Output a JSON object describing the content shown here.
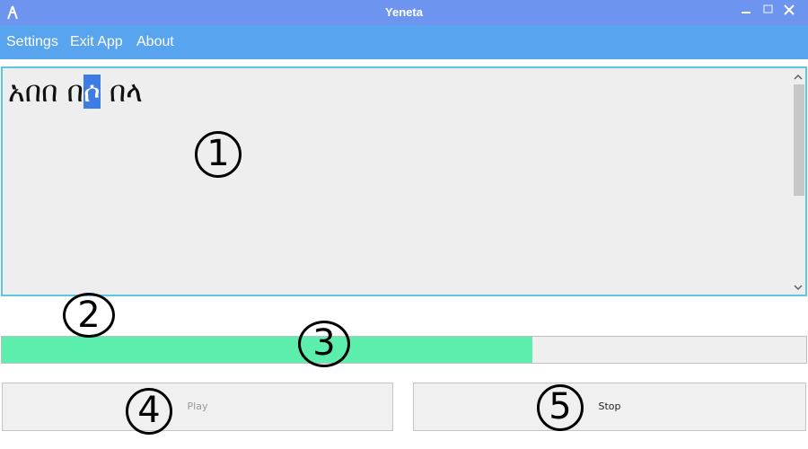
{
  "window": {
    "title": "Yeneta",
    "app_icon": "amharic-letter-icon",
    "controls": [
      "minimize-icon",
      "maximize-icon",
      "close-icon"
    ]
  },
  "menu": {
    "settings": "Settings",
    "exit_app": "Exit App",
    "about": "About"
  },
  "editor": {
    "text_before": "አበበ በ",
    "text_selected": "ሶ",
    "text_after": " በላ"
  },
  "progress": {
    "value": 0.66,
    "fill_color": "#5ceeac"
  },
  "buttons": {
    "play": "Play",
    "stop": "Stop"
  },
  "markers": [
    "1",
    "2",
    "3",
    "4",
    "5"
  ],
  "colors": {
    "titlebar": "#6d95f0",
    "menubar": "#59a4ef",
    "selection": "#3d7be5",
    "editor_border": "#5bc8e0"
  }
}
